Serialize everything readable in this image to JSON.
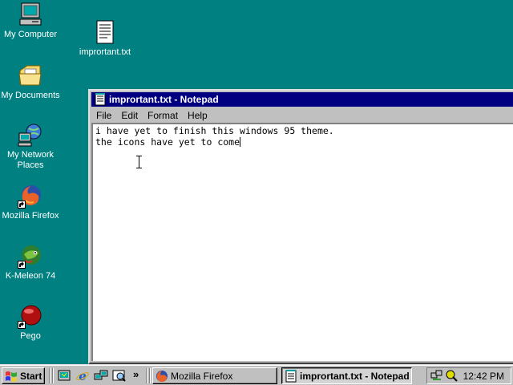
{
  "desktop": {
    "icons": [
      {
        "label": "My Computer",
        "icon": "computer-icon"
      },
      {
        "label": "My Documents",
        "icon": "folder-icon"
      },
      {
        "label": "My Network Places",
        "icon": "network-icon"
      },
      {
        "label": "Mozilla Firefox",
        "icon": "firefox-icon"
      },
      {
        "label": "K-Meleon 74",
        "icon": "kmeleon-icon"
      },
      {
        "label": "Pego",
        "icon": "pego-icon"
      },
      {
        "label": "imprortant.txt",
        "icon": "text-file-icon"
      }
    ]
  },
  "window": {
    "title": "imprortant.txt - Notepad",
    "menu": [
      "File",
      "Edit",
      "Format",
      "Help"
    ],
    "text_lines": [
      "i have yet to finish this windows 95 theme.",
      "the icons have yet to come"
    ]
  },
  "taskbar": {
    "start_label": "Start",
    "tasks": [
      {
        "label": "Mozilla Firefox",
        "icon": "firefox-icon",
        "active": false
      },
      {
        "label": "imprortant.txt - Notepad",
        "icon": "notepad-icon",
        "active": true
      }
    ],
    "quick_launch": [
      "desktop-icon",
      "ie-icon",
      "network-icon",
      "search-icon"
    ],
    "overflow_label": "»",
    "clock": "12:42 PM"
  },
  "colors": {
    "desktop": "#008080",
    "titlebar": "#000080",
    "face": "#c0c0c0"
  }
}
